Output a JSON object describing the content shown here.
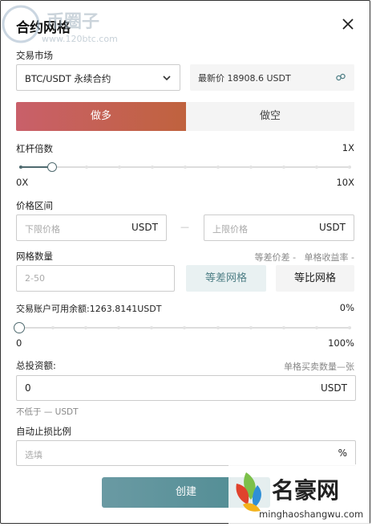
{
  "header": {
    "title": "合约网格"
  },
  "market": {
    "label": "交易市场",
    "selected": "BTC/USDT 永续合约",
    "latest_price": "最新价 18908.6 USDT"
  },
  "direction": {
    "long_label": "做多",
    "short_label": "做空"
  },
  "leverage": {
    "label": "杠杆倍数",
    "value": "1X",
    "min": "0X",
    "max": "10X",
    "level_fraction": 0.1
  },
  "price_range": {
    "label": "价格区间",
    "lower_placeholder": "下限价格",
    "upper_placeholder": "上限价格",
    "unit": "USDT",
    "separator": "—"
  },
  "grid": {
    "label": "网格数量",
    "hint": "等差价差 -   单格收益率 -",
    "placeholder": "2-50",
    "arith_label": "等差网格",
    "geo_label": "等比网格"
  },
  "balance": {
    "label": "交易账户可用余额:1263.8141USDT",
    "percent": "0%",
    "min": "0",
    "max": "100%",
    "level_fraction": 0
  },
  "investment": {
    "label": "总投资额:",
    "hint": "单格买卖数量—张",
    "value": "0",
    "unit": "USDT",
    "min_note": "不低于 — USDT"
  },
  "stop_loss": {
    "label": "自动止损比例",
    "placeholder": "选填",
    "unit": "%"
  },
  "submit": {
    "label": "创建"
  },
  "watermarks": {
    "top_left_name": "币圈子",
    "top_left_url": "www.120btc.com",
    "bottom_right_name": "名豪网",
    "bottom_right_url": "minghaoshangwu.com"
  },
  "colors": {
    "long_start": "#c9606a",
    "long_end": "#c0623e",
    "accent": "#4f6a6f",
    "create_bg": "#5a939b"
  }
}
